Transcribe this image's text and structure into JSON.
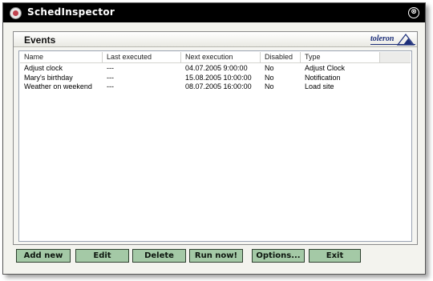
{
  "window": {
    "title": "SchedInspector",
    "close_glyph": "⊗"
  },
  "panel": {
    "title": "Events",
    "logo_text": "toleron"
  },
  "table": {
    "columns": [
      "Name",
      "Last executed",
      "Next execution",
      "Disabled",
      "Type"
    ],
    "rows": [
      [
        "Adjust clock",
        "---",
        "04.07.2005 9:00:00",
        "No",
        "Adjust Clock"
      ],
      [
        "Mary's birthday",
        "---",
        "15.08.2005 10:00:00",
        "No",
        "Notification"
      ],
      [
        "Weather on weekend",
        "---",
        "08.07.2005 16:00:00",
        "No",
        "Load site"
      ]
    ]
  },
  "buttons": {
    "add_new": "Add new",
    "edit": "Edit",
    "delete": "Delete",
    "run_now": "Run now!",
    "options": "Options...",
    "exit": "Exit"
  },
  "colors": {
    "titlebar": "#000000",
    "button_bg": "#a4c9a6",
    "logo": "#1d2f7a"
  },
  "icons": [
    "app-icon",
    "close-icon",
    "toleron-logo-icon"
  ]
}
